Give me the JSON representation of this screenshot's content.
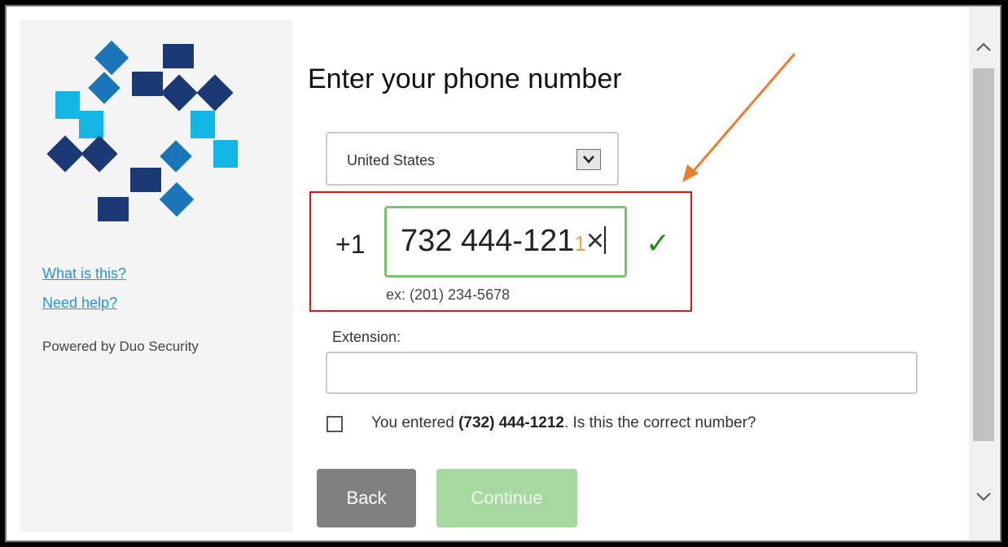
{
  "sidebar": {
    "links": [
      "What is this?",
      "Need help?"
    ],
    "powered_by": "Powered by Duo Security"
  },
  "form": {
    "title": "Enter your phone number",
    "country": "United States",
    "country_code": "+1",
    "phone_value": "732 444-121",
    "phone_suffix_char": "1",
    "clear_icon": "×",
    "valid_icon": "✓",
    "example": "ex: (201) 234-5678",
    "extension_label": "Extension:",
    "extension_value": "",
    "confirm_prefix": "You entered ",
    "confirm_number": "(732) 444-1212",
    "confirm_suffix": ". Is this the correct number?",
    "confirm_checked": false
  },
  "buttons": {
    "back": "Back",
    "continue": "Continue"
  },
  "colors": {
    "accent_green": "#7cc36b",
    "link_blue": "#2b8fd6",
    "highlight_red": "#e0141a",
    "arrow_orange": "#e77e32",
    "logo_light": "#14b6e6",
    "logo_mid": "#1a76b8",
    "logo_dark": "#1b3a75"
  },
  "icons": {
    "dropdown": "chevron-down-icon",
    "scroll_up": "chevron-up-icon",
    "scroll_down": "chevron-down-icon",
    "valid": "checkmark-icon",
    "clear": "clear-icon"
  }
}
